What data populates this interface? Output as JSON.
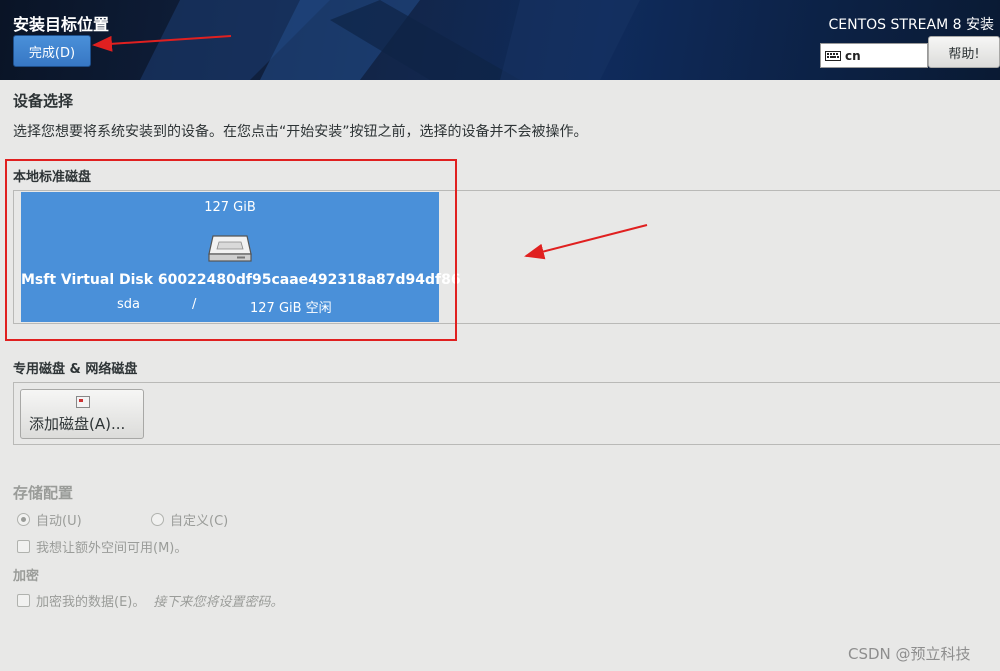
{
  "header": {
    "page_title": "安装目标位置",
    "done_label": "完成(D)",
    "product_title": "CENTOS STREAM 8 安装",
    "keyboard_layout": "cn",
    "help_label": "帮助!"
  },
  "device_selection": {
    "title": "设备选择",
    "description": "选择您想要将系统安装到的设备。在您点击“开始安装”按钮之前，选择的设备并不会被操作。"
  },
  "local_disks": {
    "label": "本地标准磁盘",
    "disks": [
      {
        "size": "127 GiB",
        "name": "Msft Virtual Disk 60022480df95caae492318a87d94df86",
        "device": "sda",
        "separator": "/",
        "free": "127 GiB 空闲",
        "selected": true
      }
    ]
  },
  "special_disks": {
    "label": "专用磁盘 & 网络磁盘",
    "add_disk_label": "添加磁盘(A)..."
  },
  "storage_config": {
    "label": "存储配置",
    "auto_label": "自动(U)",
    "custom_label": "自定义(C)",
    "extra_space_label": "我想让额外空间可用(M)。"
  },
  "encryption": {
    "label": "加密",
    "encrypt_label": "加密我的数据(E)。",
    "hint": "接下来您将设置密码。"
  },
  "watermark": "CSDN @预立科技",
  "colors": {
    "selected_tile": "#4a90d9",
    "annotation": "#e02020"
  }
}
